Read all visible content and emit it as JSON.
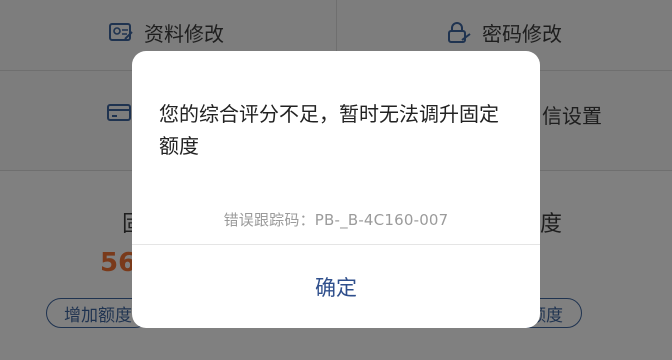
{
  "background": {
    "grid": [
      {
        "label": "资料修改",
        "icon": "profile-card-icon"
      },
      {
        "label": "密码修改",
        "icon": "lock-icon"
      },
      {
        "label": "",
        "icon": "card-icon"
      },
      {
        "label": "信设置",
        "icon": ""
      }
    ],
    "left_section_title": "固",
    "right_section_title": "度",
    "left_number": "56",
    "buttons": {
      "left_pill": "增加额度",
      "right_pill": "额度"
    }
  },
  "dialog": {
    "message": "您的综合评分不足，暂时无法调升固定额度",
    "error_code": "错误跟踪码：PB-_B-4C160-007",
    "confirm_label": "确定"
  },
  "colors": {
    "overlay_bg": "#808080",
    "dialog_bg": "#ffffff",
    "confirm_text": "#2f4f8c",
    "error_text": "#9b9b9b",
    "number_text": "#7a3a1a"
  }
}
